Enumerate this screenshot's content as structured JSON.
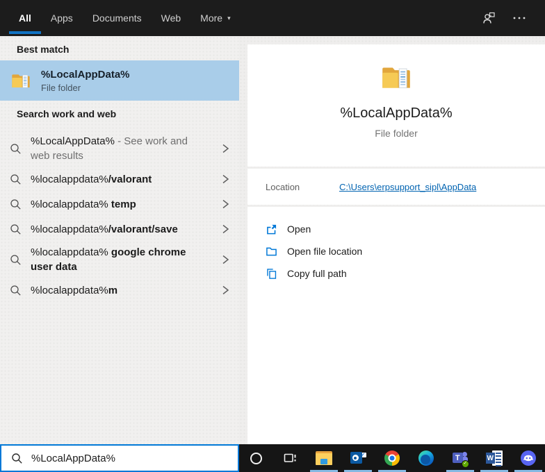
{
  "topbar": {
    "tabs": [
      {
        "label": "All",
        "active": true
      },
      {
        "label": "Apps",
        "active": false
      },
      {
        "label": "Documents",
        "active": false
      },
      {
        "label": "Web",
        "active": false
      },
      {
        "label": "More",
        "active": false,
        "caret": "▾"
      }
    ],
    "icons": [
      "user-account-icon",
      "more-options-icon"
    ]
  },
  "left": {
    "best_match_header": "Best match",
    "best_match": {
      "title": "%LocalAppData%",
      "subtitle": "File folder"
    },
    "search_header": "Search work and web",
    "suggestions": [
      {
        "query": "%LocalAppData%",
        "suffix": " - See work and web results"
      },
      {
        "query": "%localappdata%",
        "completion": "/valorant"
      },
      {
        "query": "%localappdata% ",
        "completion": "temp"
      },
      {
        "query": "%localappdata%",
        "completion": "/valorant/save"
      },
      {
        "query": "%localappdata% ",
        "completion": "google chrome user data"
      },
      {
        "query": "%localappdata%",
        "completion": "m"
      }
    ]
  },
  "preview": {
    "title": "%LocalAppData%",
    "subtitle": "File folder",
    "location_label": "Location",
    "location_link": "C:\\Users\\erpsupport_sipl\\AppData",
    "actions": [
      {
        "icon": "open-icon",
        "label": "Open"
      },
      {
        "icon": "open-file-location-icon",
        "label": "Open file location"
      },
      {
        "icon": "copy-icon",
        "label": "Copy full path"
      }
    ]
  },
  "searchbox": {
    "value": "%LocalAppData%"
  },
  "taskbar": {
    "items": [
      {
        "name": "cortana",
        "running": false
      },
      {
        "name": "task-view",
        "running": false
      },
      {
        "name": "file-explorer",
        "running": true
      },
      {
        "name": "outlook",
        "running": true
      },
      {
        "name": "chrome",
        "running": true
      },
      {
        "name": "edge",
        "running": false
      },
      {
        "name": "teams",
        "running": true
      },
      {
        "name": "word",
        "running": true
      },
      {
        "name": "discord",
        "running": true
      }
    ]
  },
  "colors": {
    "accent": "#0078d7",
    "tab_underline": "#1173c4",
    "best_match_highlight": "#a9cde9",
    "link": "#0063b1",
    "taskbar_running_indicator": "#85b9e3"
  }
}
